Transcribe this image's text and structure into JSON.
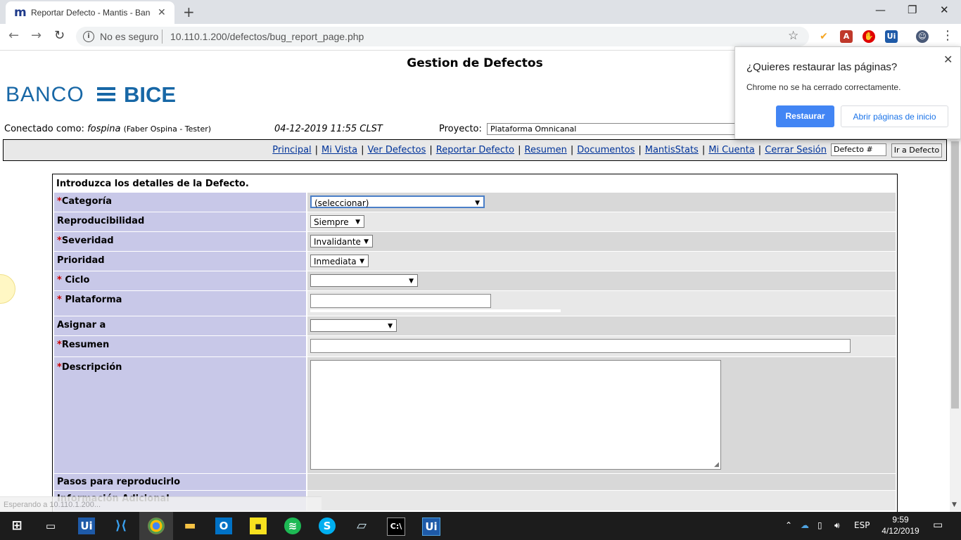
{
  "browser": {
    "tab_title": "Reportar Defecto - Mantis - Banco",
    "favicon": "m",
    "security_label": "No es seguro",
    "url": "10.110.1.200/defectos/bug_report_page.php",
    "extensions": [
      {
        "name": "extension-icon",
        "glyph": "✔",
        "color": "#f5a623"
      },
      {
        "name": "pdf-extension-icon",
        "glyph": "A",
        "color": "#c0392b"
      },
      {
        "name": "adblock-icon",
        "glyph": "✋",
        "color": "#e00000"
      },
      {
        "name": "uipath-extension-icon",
        "glyph": "Ui",
        "color": "#1e5aa8"
      }
    ]
  },
  "restore_popup": {
    "title": "¿Quieres restaurar las páginas?",
    "message": "Chrome no se ha cerrado correctamente.",
    "restore_label": "Restaurar",
    "open_label": "Abrir páginas de inicio"
  },
  "page": {
    "title": "Gestion de Defectos",
    "logo_banco": "BANCO",
    "logo_bice": "BICE",
    "login_prefix": "Conectado como:",
    "login_user": "fospina",
    "login_fullname": "(Faber Ospina - Tester)",
    "datetime": "04-12-2019 11:55 CLST",
    "project_label": "Proyecto:",
    "project_value": "Plataforma Omnicanal"
  },
  "menu": {
    "items": [
      "Principal",
      "Mi Vista",
      "Ver Defectos",
      "Reportar Defecto",
      "Resumen",
      "Documentos",
      "MantisStats",
      "Mi Cuenta",
      "Cerrar Sesión"
    ],
    "bug_placeholder": "Defecto #",
    "go_label": "Ir a Defecto"
  },
  "form": {
    "heading": "Introduzca los detalles de la Defecto.",
    "fields": {
      "categoria": {
        "label": "Categoría",
        "value": "(seleccionar)"
      },
      "reproducibilidad": {
        "label": "Reproducibilidad",
        "value": "Siempre"
      },
      "severidad": {
        "label": "Severidad",
        "value": "Invalidante"
      },
      "prioridad": {
        "label": "Prioridad",
        "value": "Inmediata"
      },
      "ciclo": {
        "label": " Ciclo",
        "value": ""
      },
      "plataforma": {
        "label": " Plataforma",
        "value": ""
      },
      "asignar": {
        "label": "Asignar a",
        "value": ""
      },
      "resumen": {
        "label": "Resumen",
        "value": ""
      },
      "descripcion": {
        "label": "Descripción",
        "value": ""
      },
      "pasos": {
        "label": "Pasos para reproducirlo"
      },
      "info": {
        "label": "Información Adicional"
      }
    },
    "required_marker": "*"
  },
  "status_bar": "Esperando a 10.110.1.200...",
  "taskbar": {
    "language": "ESP",
    "time": "9:59",
    "date": "4/12/2019"
  }
}
